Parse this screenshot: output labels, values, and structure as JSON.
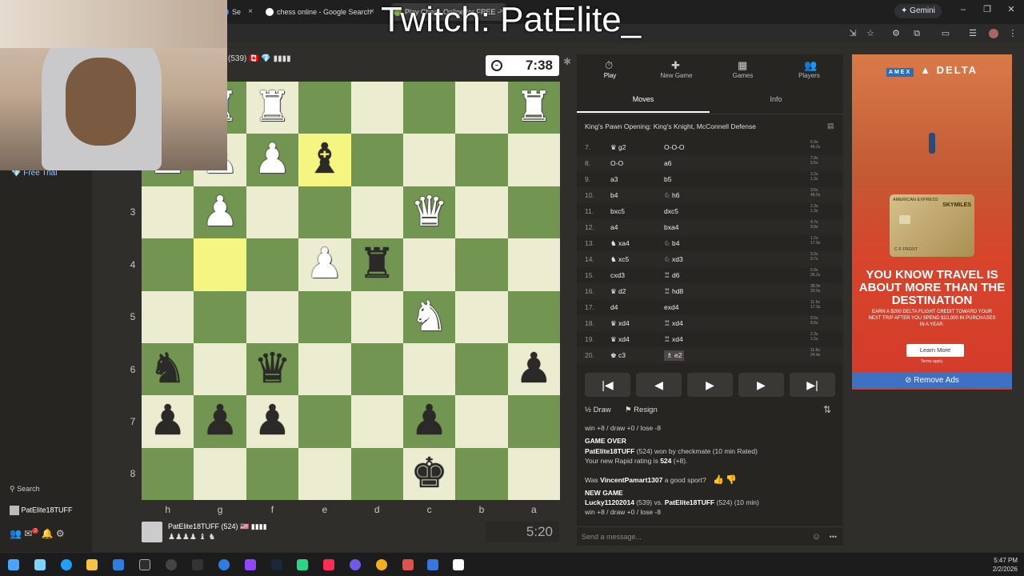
{
  "browser": {
    "tabs": [
      {
        "label": "Se",
        "close": "×"
      },
      {
        "label": "chess online - Google Search",
        "close": "×"
      },
      {
        "label": "Play Chess Online for FREE - 2",
        "close": "×"
      }
    ],
    "gemini_label": "Gemini"
  },
  "overlay": {
    "twitch": "Twitch: PatElite_"
  },
  "sidebar": {
    "free_trial": "Free Trial",
    "search": "Search",
    "username": "PatElite18TUFF",
    "mail_badge": "2"
  },
  "opponent": {
    "rating_text": "(539)",
    "clock": "7:38"
  },
  "player": {
    "name": "PatElite18TUFF (524)",
    "captured": "♟♟♟♟ ♝ ♞",
    "clock": "5:20"
  },
  "board": {
    "ranks": [
      "3",
      "4",
      "5",
      "6",
      "7",
      "8"
    ],
    "files": [
      "h",
      "g",
      "f",
      "e",
      "d",
      "c",
      "b",
      "a"
    ]
  },
  "panel": {
    "tabs": [
      {
        "label": "Play",
        "icon": "⏱"
      },
      {
        "label": "New Game",
        "icon": "✚"
      },
      {
        "label": "Games",
        "icon": "▦"
      },
      {
        "label": "Players",
        "icon": "👥"
      }
    ],
    "subtabs": [
      "Moves",
      "Info"
    ],
    "opening": "King's Pawn Opening: King's Knight, McConnell Defense",
    "moves": [
      {
        "n": "7.",
        "w": "♛ g2",
        "b": "O-O-O",
        "t1": "6.9s",
        "t2": "46.2s"
      },
      {
        "n": "8.",
        "w": "O-O",
        "b": "a6",
        "t1": "7.9s",
        "t2": "9.5s"
      },
      {
        "n": "9.",
        "w": "a3",
        "b": "b5",
        "t1": "3.2s",
        "t2": "1.3s"
      },
      {
        "n": "10.",
        "w": "b4",
        "b": "♘ h6",
        "t1": "3.5s",
        "t2": "46.5s"
      },
      {
        "n": "11.",
        "w": "bxc5",
        "b": "dxc5",
        "t1": "2.3s",
        "t2": "1.3s"
      },
      {
        "n": "12.",
        "w": "a4",
        "b": "bxa4",
        "t1": "4.7s",
        "t2": "9.9s"
      },
      {
        "n": "13.",
        "w": "♞ xa4",
        "b": "♘ b4",
        "t1": "1.2s",
        "t2": "17.9s"
      },
      {
        "n": "14.",
        "w": "♞ xc5",
        "b": "♘ xd3",
        "t1": "3.2s",
        "t2": "9.7s"
      },
      {
        "n": "15.",
        "w": "cxd3",
        "b": "♖ d6",
        "t1": "5.9s",
        "t2": "26.2s"
      },
      {
        "n": "16.",
        "w": "♛ d2",
        "b": "♖ hd8",
        "t1": "38.9s",
        "t2": "33.0s"
      },
      {
        "n": "17.",
        "w": "d4",
        "b": "exd4",
        "t1": "11.5s",
        "t2": "17.3s"
      },
      {
        "n": "18.",
        "w": "♛ xd4",
        "b": "♖ xd4",
        "t1": "9.5s",
        "t2": "8.6s"
      },
      {
        "n": "19.",
        "w": "♛ xd4",
        "b": "♖ xd4",
        "t1": "2.3s",
        "t2": "1.5s"
      },
      {
        "n": "20.",
        "w": "♚ c3",
        "b": "♗ e2",
        "t1": "11.6s",
        "t2": "24.4s"
      }
    ],
    "nav": [
      "|◀",
      "◀",
      "▶",
      "▶|"
    ],
    "draw": "Draw",
    "resign": "Resign",
    "chat": {
      "line1": "win +8 / draw +0 / lose -8",
      "game_over": "GAME OVER",
      "winner_name": "PatElite18TUFF",
      "winner_rest": "(524) won by checkmate (10 min Rated)",
      "rating_pre": "Your new Rapid rating is",
      "rating_val": "524",
      "rating_post": "(+8).",
      "sport_pre": "Was",
      "sport_name": "VincentPamart1307",
      "sport_post": "a good sport?",
      "new_game": "NEW GAME",
      "ng_p1": "Lucky11202014",
      "ng_mid": "(539) vs.",
      "ng_p2": "PatElite18TUFF",
      "ng_post": "(524) (10 min)",
      "line_last": "win +8 / draw +0 / lose -8"
    },
    "message_placeholder": "Send a message..."
  },
  "ad": {
    "brand": "DELTA",
    "amex": "AMEX",
    "card_brand": "AMERICAN EXPRESS",
    "card_skymiles": "SKYMILES",
    "card_name": "C F FROST",
    "headline": "YOU KNOW TRAVEL IS ABOUT MORE THAN THE DESTINATION",
    "sub": "EARN A $200 DELTA FLIGHT CREDIT TOWARD YOUR NEXT TRIP AFTER YOU SPEND $10,000 IN PURCHASES IN A YEAR.",
    "button": "Learn More",
    "terms": "Terms apply.",
    "remove": "Remove Ads"
  },
  "taskbar": {
    "time": "5:47 PM",
    "date": "2/2/2026"
  },
  "colors": {
    "board_light": "#ebecd0",
    "board_dark": "#739552",
    "highlight": "#f5f682",
    "ad_button": "#3e71c2"
  }
}
